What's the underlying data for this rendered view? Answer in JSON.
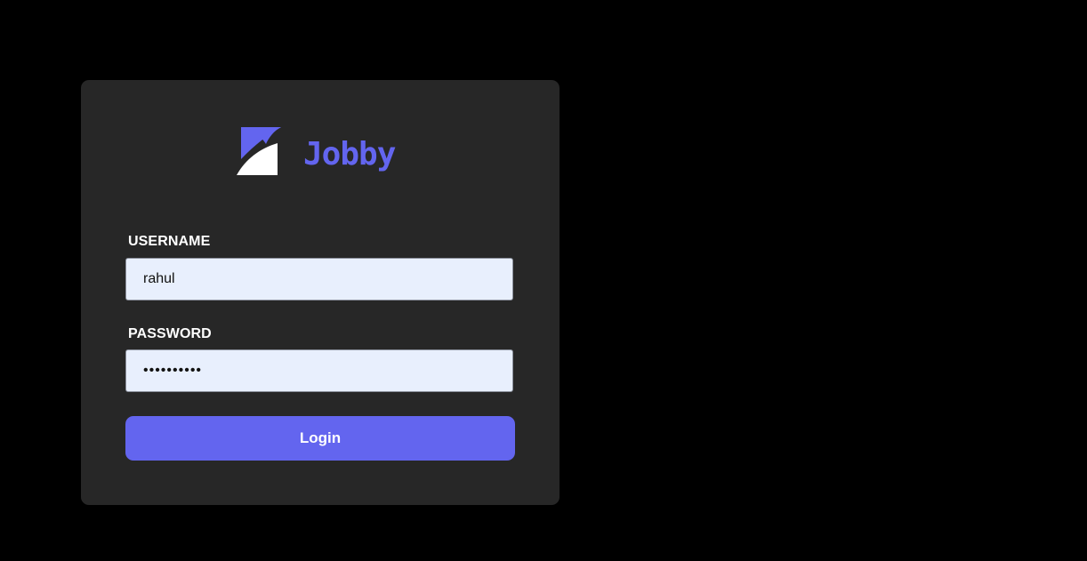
{
  "brand": {
    "name": "Jobby",
    "logo_icon": "jobby-logo-icon",
    "color": "#6365ef"
  },
  "form": {
    "username": {
      "label": "USERNAME",
      "value": "rahul"
    },
    "password": {
      "label": "PASSWORD",
      "value": "rahul@2021"
    },
    "submit_label": "Login"
  },
  "colors": {
    "page_background": "#000000",
    "card_background": "#272727",
    "input_background": "#e8effd",
    "accent": "#6365ef"
  }
}
